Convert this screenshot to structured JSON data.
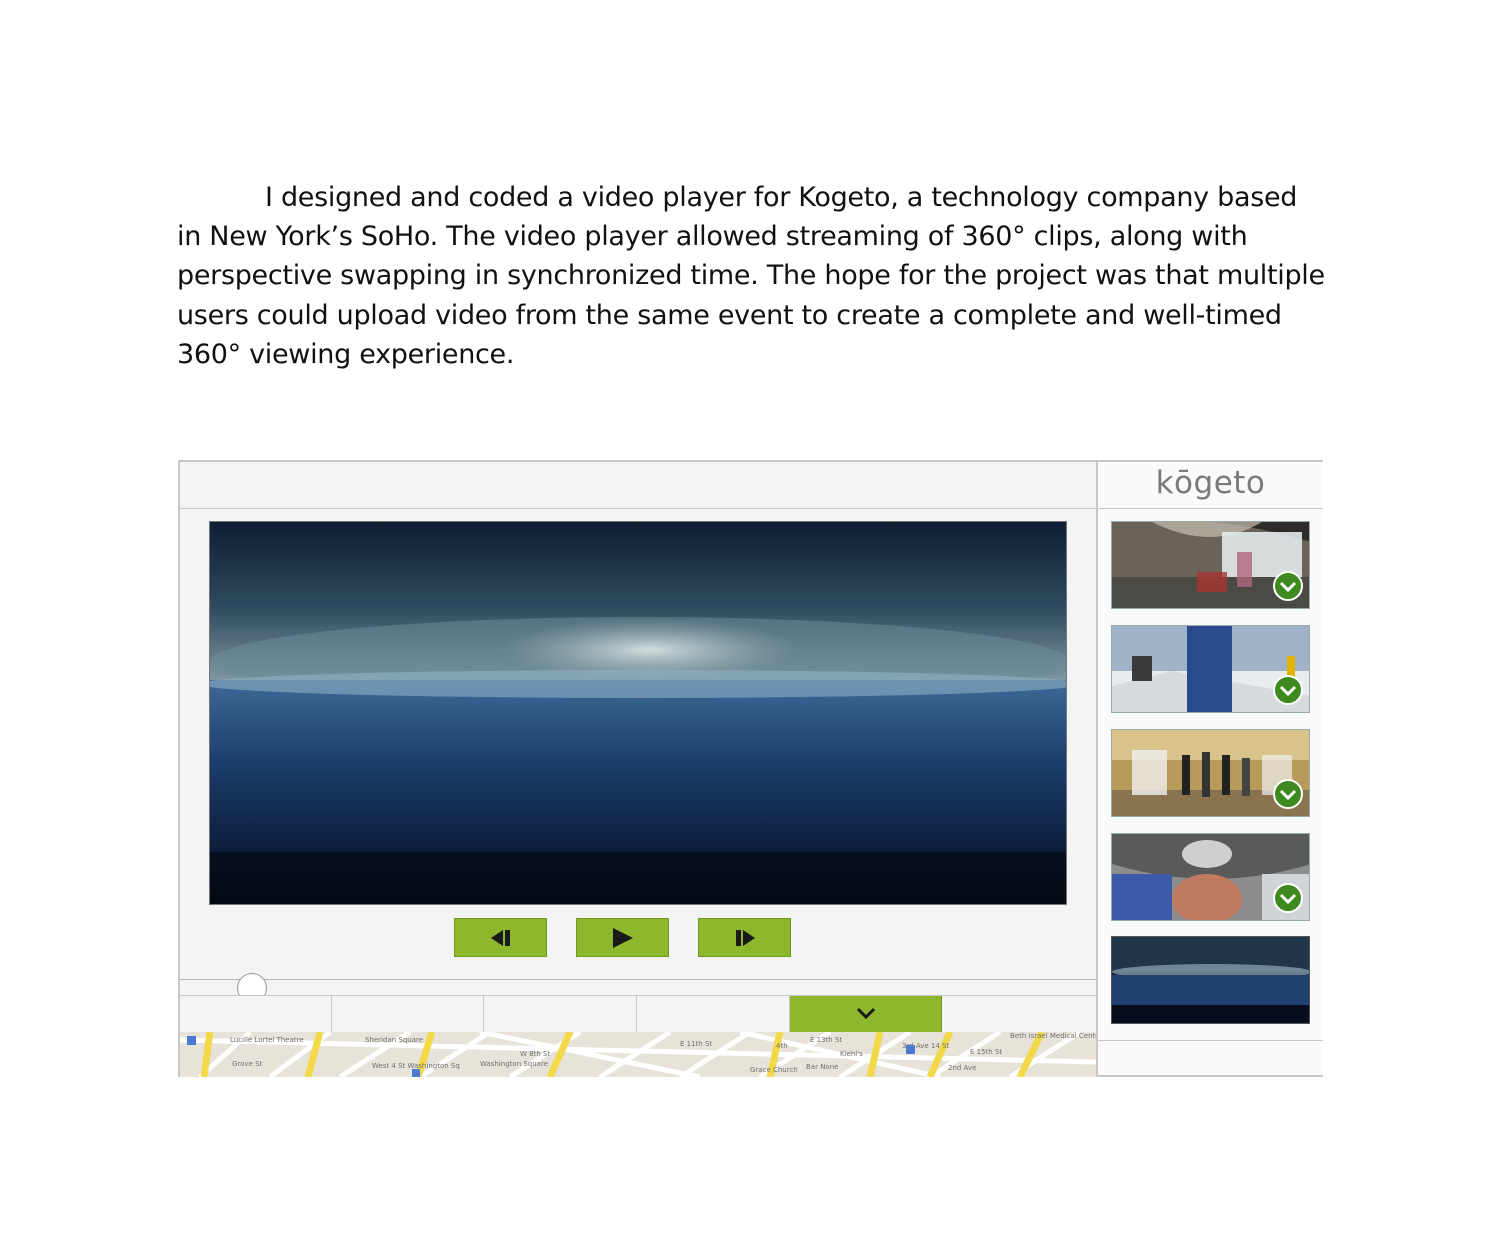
{
  "intro": {
    "text": "I designed and coded a video player for Kogeto, a technology company based in New York’s SoHo. The video player allowed streaming of 360° clips, along with perspective swapping in synchronized time. The hope for the project was that multiple users could upload video from the same event to create a complete and well-timed 360° viewing experience."
  },
  "player": {
    "brand": "kōgeto",
    "controls": [
      {
        "icon": "step-back-icon"
      },
      {
        "icon": "play-icon"
      },
      {
        "icon": "step-forward-icon"
      }
    ],
    "scrub_position": 0.07,
    "tabs_count": 6,
    "active_tab_index": 4,
    "active_tab_icon": "chevron-down-icon",
    "thumbnails": [
      {
        "scene": "street-360",
        "selected": true
      },
      {
        "scene": "snow-360",
        "selected": true
      },
      {
        "scene": "room-360",
        "selected": true
      },
      {
        "scene": "closeup-360",
        "selected": true
      },
      {
        "scene": "ocean-360",
        "selected": false
      }
    ],
    "map_labels": [
      "Lucille Lortel Theatre",
      "Grove St",
      "Sheridan Square",
      "West 4 St Washington Sq",
      "Washington Square",
      "W 8th St",
      "E 11th St",
      "4th",
      "E 13th St",
      "Kiehl's",
      "3rd Ave 14 St",
      "E 15th St",
      "Beth Israel Medical Center",
      "Grace Church",
      "Bar None",
      "2nd Ave"
    ],
    "accent_color": "#8db72d",
    "check_color": "#3f8a1f"
  }
}
